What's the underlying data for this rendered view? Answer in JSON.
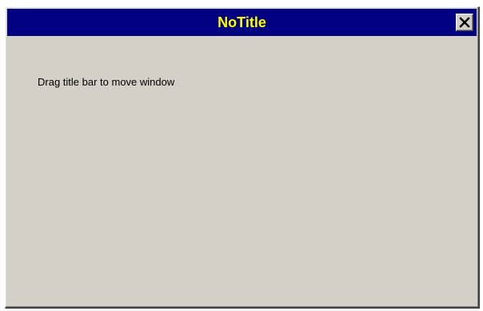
{
  "window": {
    "title": "NoTitle",
    "close_icon": "close-icon",
    "message": "Drag title bar to move window"
  },
  "colors": {
    "titlebar_bg": "#000080",
    "title_text": "#ffff00",
    "window_bg": "#d4d0c8"
  }
}
